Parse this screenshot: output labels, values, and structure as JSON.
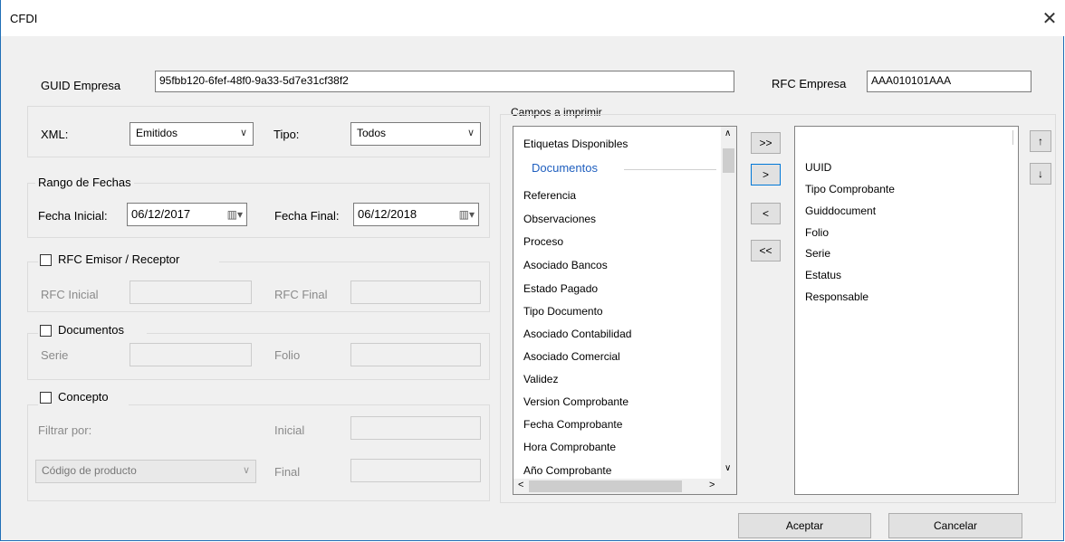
{
  "window": {
    "title": "CFDI",
    "close": "✕"
  },
  "guid": {
    "label": "GUID Empresa",
    "value": "95fbb120-6fef-48f0-9a33-5d7e31cf38f2"
  },
  "rfc_empresa": {
    "label": "RFC Empresa",
    "value": "AAA010101AAA"
  },
  "xml": {
    "label": "XML:",
    "value": "Emitidos"
  },
  "tipo": {
    "label": "Tipo:",
    "value": "Todos"
  },
  "rango": {
    "title": "Rango de Fechas",
    "inicial_label": "Fecha Inicial:",
    "inicial_value": "06/12/2017",
    "final_label": "Fecha Final:",
    "final_value": "06/12/2018"
  },
  "rfc_section": {
    "title": "RFC Emisor / Receptor",
    "inicial_label": "RFC Inicial",
    "final_label": "RFC Final"
  },
  "documentos": {
    "title": "Documentos",
    "serie_label": "Serie",
    "folio_label": "Folio"
  },
  "concepto": {
    "title": "Concepto",
    "filtrar_label": "Filtrar por:",
    "filtrar_value": "Código de producto",
    "inicial_label": "Inicial",
    "final_label": "Final"
  },
  "campos": {
    "title": "Campos a imprimir",
    "available_header": "Etiquetas Disponibles",
    "group_header": "Documentos",
    "available": [
      "Referencia",
      "Observaciones",
      "Proceso",
      "Asociado Bancos",
      "Estado Pagado",
      "Tipo Documento",
      "Asociado Contabilidad",
      "Asociado Comercial",
      "Validez",
      "Version Comprobante",
      "Fecha Comprobante",
      "Hora Comprobante",
      "Año Comprobante"
    ],
    "selected": [
      "UUID",
      "Tipo Comprobante",
      "Guiddocument",
      "Folio",
      "Serie",
      "Estatus",
      "Responsable"
    ],
    "buttons": {
      "add_all": ">>",
      "add": ">",
      "remove": "<",
      "remove_all": "<<",
      "up": "↑",
      "down": "↓"
    }
  },
  "footer": {
    "accept": "Aceptar",
    "cancel": "Cancelar"
  }
}
